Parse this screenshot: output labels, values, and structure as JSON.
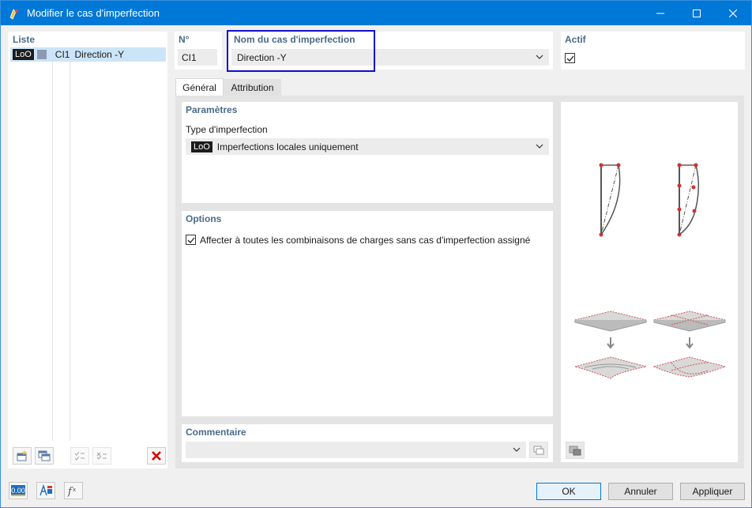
{
  "window": {
    "title": "Modifier le cas d'imperfection"
  },
  "list": {
    "header": "Liste",
    "items": [
      {
        "tag": "LoO",
        "id": "CI1",
        "name": "Direction -Y"
      }
    ]
  },
  "number": {
    "label": "N°",
    "value": "CI1"
  },
  "name_field": {
    "label": "Nom du cas d'imperfection",
    "value": "Direction -Y"
  },
  "active": {
    "label": "Actif",
    "checked": true
  },
  "tabs": [
    {
      "label": "Général",
      "active": true
    },
    {
      "label": "Attribution",
      "active": false
    }
  ],
  "parameters": {
    "header": "Paramètres",
    "type_label": "Type d'imperfection",
    "type_tag": "LoO",
    "type_value": "Imperfections locales uniquement"
  },
  "options": {
    "header": "Options",
    "checkbox_label": "Affecter à toutes les combinaisons de charges sans cas d'imperfection assigné",
    "checked": true
  },
  "comment": {
    "header": "Commentaire",
    "value": ""
  },
  "buttons": {
    "ok": "OK",
    "cancel": "Annuler",
    "apply": "Appliquer"
  },
  "bottom_tools": {
    "units_value": "0.00"
  },
  "colors": {
    "titlebar": "#0078d7",
    "highlight_border": "#1010d0",
    "selection": "#cce4f7",
    "section_header": "#4a6b8a",
    "delete_red": "#d40000"
  }
}
